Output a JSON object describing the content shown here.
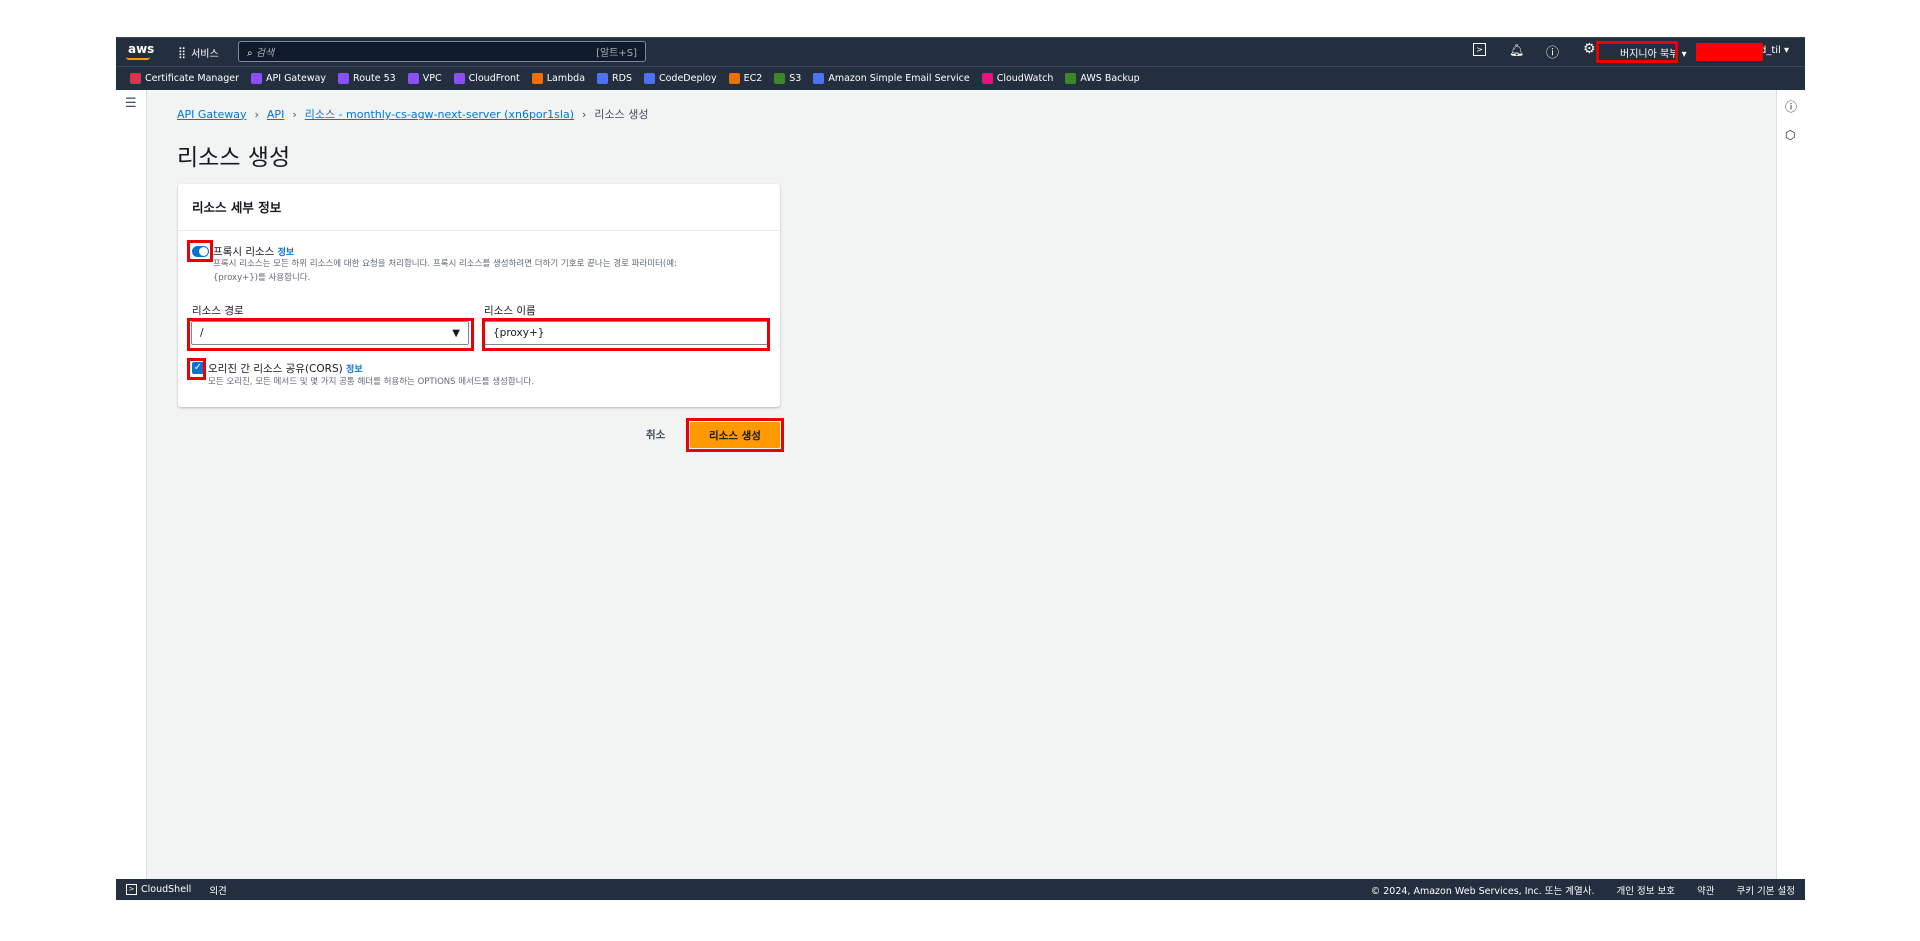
{
  "topbar": {
    "logo": "aws",
    "services": "서비스",
    "search_placeholder": "검색",
    "search_shortcut": "[알트+S]",
    "region": "버지니아 북부",
    "account": "d_til"
  },
  "favorites": [
    {
      "label": "Certificate Manager",
      "color": "#dd344c"
    },
    {
      "label": "API Gateway",
      "color": "#8c4fff"
    },
    {
      "label": "Route 53",
      "color": "#8c4fff"
    },
    {
      "label": "VPC",
      "color": "#8c4fff"
    },
    {
      "label": "CloudFront",
      "color": "#8c4fff"
    },
    {
      "label": "Lambda",
      "color": "#ed7100"
    },
    {
      "label": "RDS",
      "color": "#4d72f3"
    },
    {
      "label": "CodeDeploy",
      "color": "#4d72f3"
    },
    {
      "label": "EC2",
      "color": "#ed7100"
    },
    {
      "label": "S3",
      "color": "#3f8624"
    },
    {
      "label": "Amazon Simple Email Service",
      "color": "#4d72f3"
    },
    {
      "label": "CloudWatch",
      "color": "#e7157b"
    },
    {
      "label": "AWS Backup",
      "color": "#3f8624"
    }
  ],
  "breadcrumb": [
    "API Gateway",
    "API",
    "리소스 - monthly-cs-agw-next-server (xn6por1sla)",
    "리소스 생성"
  ],
  "page_title": "리소스 생성",
  "card": {
    "title": "리소스 세부 정보",
    "proxy_label": "프록시 리소스",
    "proxy_info": "정보",
    "proxy_desc1": "프록시 리소스는 모든 하위 리소스에 대한 요청을 처리합니다. 프록시 리소스를 생성하려면 더하기 기호로 끝나는 경로 파라미터(예:",
    "proxy_desc2": "{proxy+})를 사용합니다.",
    "proxy_enabled": true,
    "path_label": "리소스 경로",
    "path_value": "/",
    "name_label": "리소스 이름",
    "name_value": "{proxy+}",
    "cors_label": "오리진 간 리소스 공유(CORS)",
    "cors_info": "정보",
    "cors_desc": "모든 오리진, 모든 메서드 및 몇 가지 공통 헤더를 허용하는 OPTIONS 메서드를 생성합니다.",
    "cors_checked": true
  },
  "actions": {
    "cancel": "취소",
    "create": "리소스 생성"
  },
  "footer": {
    "cloudshell": "CloudShell",
    "feedback": "의견",
    "copyright": "© 2024, Amazon Web Services, Inc. 또는 계열사.",
    "privacy": "개인 정보 보호",
    "terms": "약관",
    "cookies": "쿠키 기본 설정"
  }
}
